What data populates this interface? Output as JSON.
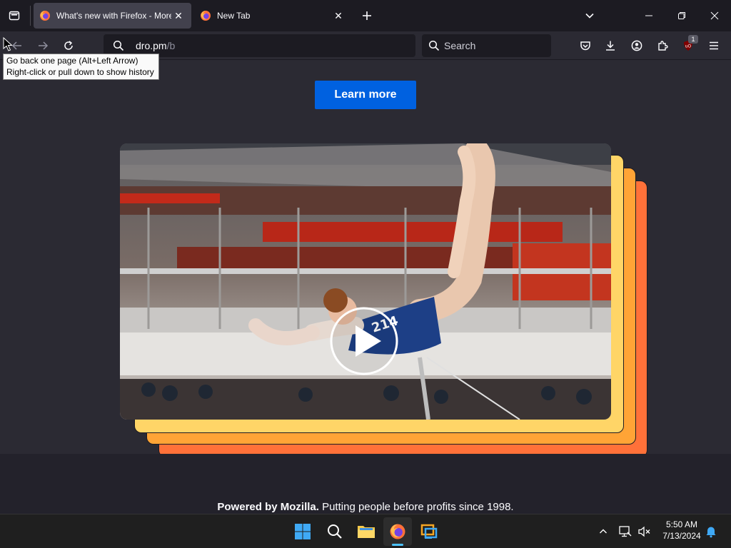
{
  "browser": {
    "tabs": [
      {
        "title": "What's new with Firefox - More",
        "active": true
      },
      {
        "title": "New Tab",
        "active": false
      }
    ],
    "url": {
      "host": "dro.pm",
      "path": "/b"
    },
    "search_placeholder": "Search",
    "extension_badge": "1",
    "tooltip": {
      "line1": "Go back one page (Alt+Left Arrow)",
      "line2": "Right-click or pull down to show history"
    }
  },
  "page": {
    "learn_more": "Learn more",
    "video": {
      "jersey_number": "214"
    },
    "footer": {
      "strong": "Powered by Mozilla.",
      "rest": " Putting people before profits since 1998."
    }
  },
  "taskbar": {
    "time": "5:50 AM",
    "date": "7/13/2024"
  },
  "colors": {
    "accent_button": "#0061e0",
    "card_yellow": "#ffd567",
    "card_amber": "#ffa436",
    "card_orange": "#ff7139"
  }
}
